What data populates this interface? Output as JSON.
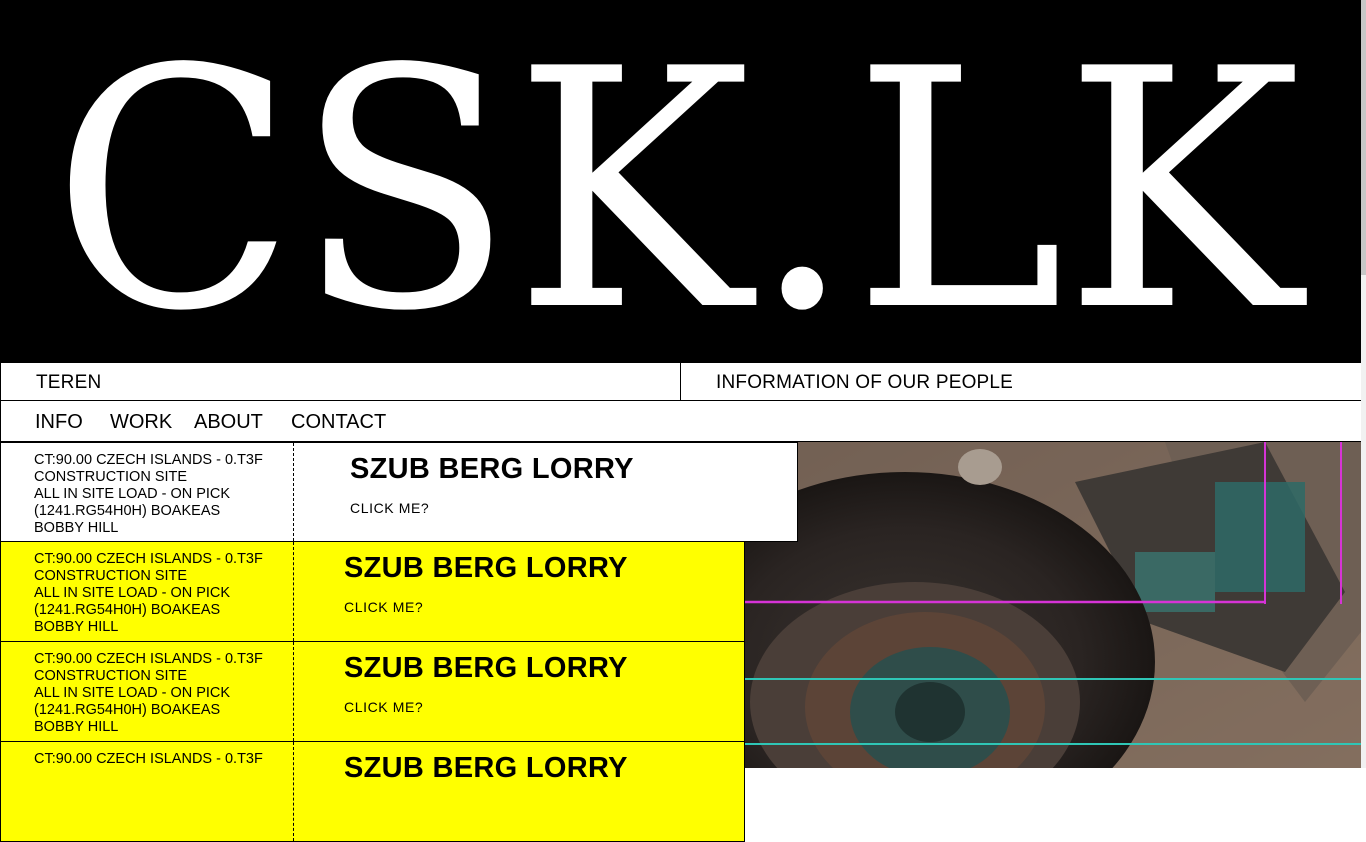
{
  "brand": {
    "logo_text": "CSK.LK"
  },
  "top_bar": {
    "left_label": "TEREN",
    "right_label": "INFORMATION OF OUR PEOPLE"
  },
  "nav": {
    "items": [
      "INFO",
      "WORK",
      "ABOUT",
      "CONTACT"
    ]
  },
  "cards": [
    {
      "meta": [
        "CT:90.00 CZECH ISLANDS - 0.T3F",
        "CONSTRUCTION SITE",
        "ALL IN SITE LOAD - ON PICK",
        "(1241.RG54H0H) BOAKEAS",
        "BOBBY HILL"
      ],
      "title": "SZUB BERG LORRY",
      "cta": "CLICK ME?",
      "bg": "#ffffff"
    },
    {
      "meta": [
        "CT:90.00 CZECH ISLANDS - 0.T3F",
        "CONSTRUCTION SITE",
        "ALL IN SITE LOAD - ON PICK",
        "(1241.RG54H0H) BOAKEAS",
        "BOBBY HILL"
      ],
      "title": "SZUB BERG LORRY",
      "cta": "CLICK ME?",
      "bg": "#ffff00"
    },
    {
      "meta": [
        "CT:90.00 CZECH ISLANDS - 0.T3F",
        "CONSTRUCTION SITE",
        "ALL IN SITE LOAD - ON PICK",
        "(1241.RG54H0H) BOAKEAS",
        "BOBBY HILL"
      ],
      "title": "SZUB BERG LORRY",
      "cta": "CLICK ME?",
      "bg": "#ffff00"
    },
    {
      "meta": [
        "CT:90.00 CZECH ISLANDS - 0.T3F"
      ],
      "title": "SZUB BERG LORRY",
      "cta": "",
      "bg": "#ffff00"
    }
  ],
  "colors": {
    "accent_yellow": "#ffff00",
    "line_magenta": "#d633d6",
    "line_teal": "#2fc6b6"
  }
}
